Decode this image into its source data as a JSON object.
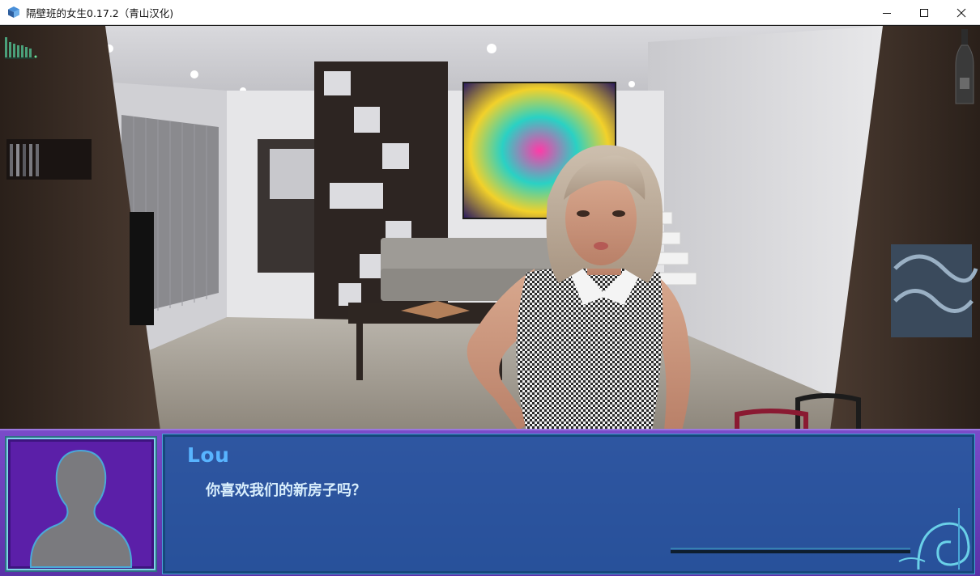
{
  "window": {
    "title": "隔壁班的女生0.17.2（青山汉化)",
    "icon": "app-cube-icon",
    "controls": [
      "minimize-icon",
      "maximize-icon",
      "close-icon"
    ]
  },
  "scene": {
    "description_icons": [
      "hud-bars-icon",
      "bottle-icon"
    ]
  },
  "dialogue": {
    "speaker": "Lou",
    "text": "你喜欢我们的新房子吗？",
    "speaker_color": "#58b4ff",
    "text_color": "#d8eefc",
    "box_color": "#6a3dbb",
    "panel_color": "#1e5a96"
  }
}
